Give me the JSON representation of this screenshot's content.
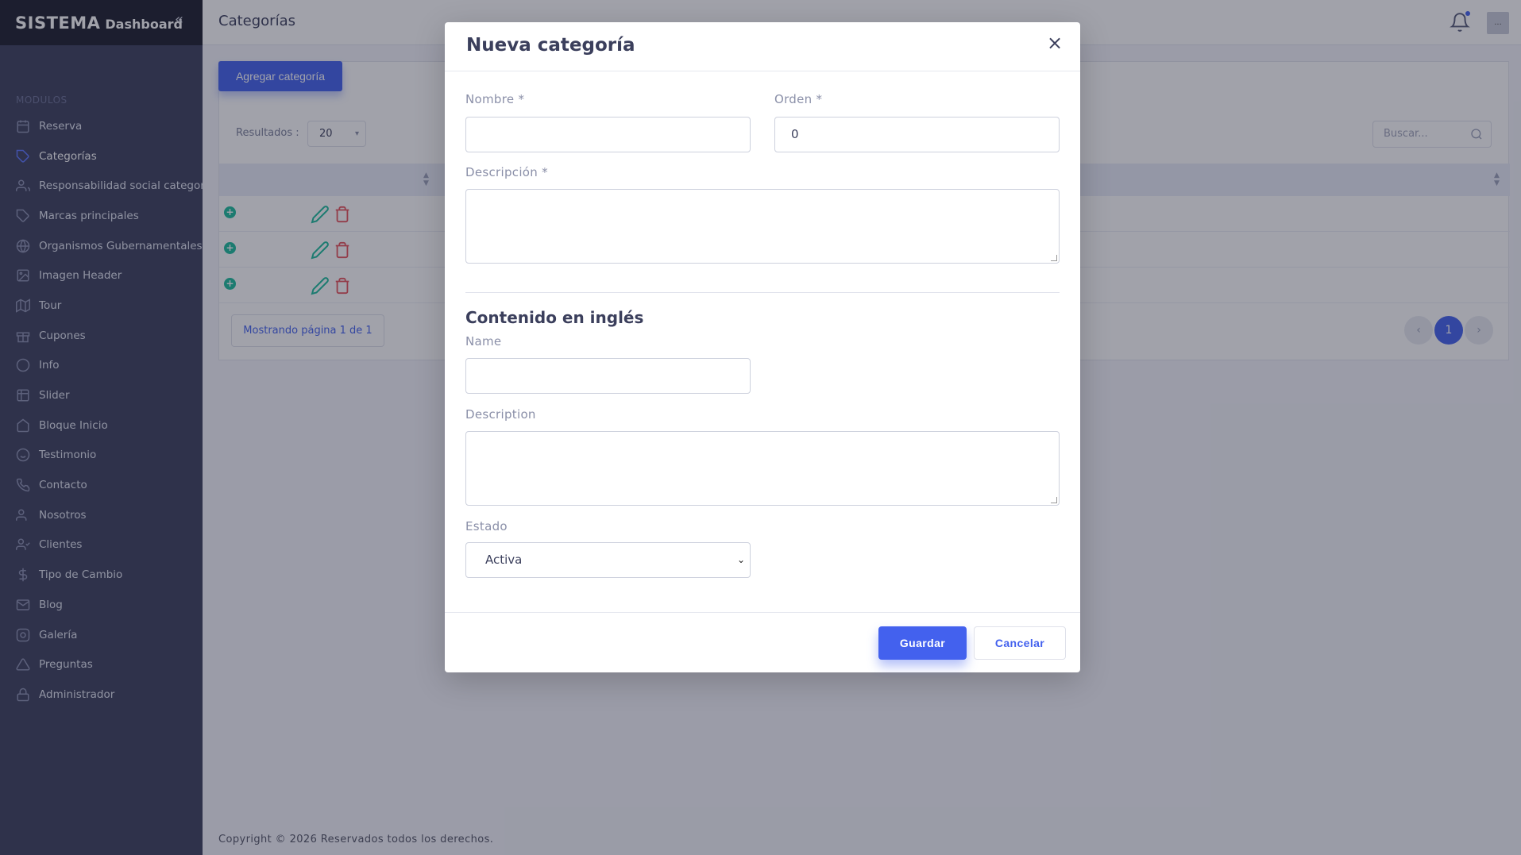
{
  "brand": {
    "main": "SISTEMA",
    "sub": "Dashboard",
    "collapse_icon": "«"
  },
  "sidebar": {
    "section_title": "MODULOS",
    "items": [
      {
        "label": "Reserva",
        "icon": "calendar-icon"
      },
      {
        "label": "Categorías",
        "icon": "tag-icon",
        "active": true
      },
      {
        "label": "Responsabilidad social categoría",
        "icon": "users-icon"
      },
      {
        "label": "Marcas principales",
        "icon": "tag-icon"
      },
      {
        "label": "Organismos Gubernamentales",
        "icon": "globe-icon"
      },
      {
        "label": "Imagen Header",
        "icon": "image-icon"
      },
      {
        "label": "Tour",
        "icon": "map-icon"
      },
      {
        "label": "Cupones",
        "icon": "gift-icon"
      },
      {
        "label": "Info",
        "icon": "info-icon"
      },
      {
        "label": "Slider",
        "icon": "grid-icon"
      },
      {
        "label": "Bloque Inicio",
        "icon": "home-icon"
      },
      {
        "label": "Testimonio",
        "icon": "smile-icon"
      },
      {
        "label": "Contacto",
        "icon": "phone-icon"
      },
      {
        "label": "Nosotros",
        "icon": "users-icon"
      },
      {
        "label": "Clientes",
        "icon": "user-check-icon"
      },
      {
        "label": "Tipo de Cambio",
        "icon": "dollar-icon"
      },
      {
        "label": "Blog",
        "icon": "mail-icon"
      },
      {
        "label": "Galería",
        "icon": "camera-icon"
      },
      {
        "label": "Preguntas",
        "icon": "alert-icon"
      },
      {
        "label": "Administrador",
        "icon": "lock-icon"
      }
    ]
  },
  "header": {
    "title": "Categorías",
    "avatar_text": "..."
  },
  "main": {
    "add_button": "Agregar categoría",
    "results_label": "Resultados :",
    "results_value": "20",
    "search_placeholder": "Buscar...",
    "plus_symbol": "+",
    "page_info": "Mostrando página 1 de 1",
    "pagination": {
      "prev": "‹",
      "current": "1",
      "next": "›"
    }
  },
  "footer": {
    "copyright": "Copyright © 2026 Reservados todos los derechos."
  },
  "modal": {
    "title": "Nueva categoría",
    "close": "×",
    "fields": {
      "nombre_label": "Nombre *",
      "nombre_value": "",
      "orden_label": "Orden *",
      "orden_value": "0",
      "descripcion_label": "Descripción *",
      "section_title": "Contenido en inglés",
      "name_label": "Name",
      "description_label": "Description",
      "estado_label": "Estado",
      "estado_value": "Activa"
    },
    "save_label": "Guardar",
    "cancel_label": "Cancelar"
  },
  "colors": {
    "primary": "#4361ee",
    "sidebar": "#3b3f5c",
    "success": "#1abc9c",
    "danger": "#e7515a"
  }
}
